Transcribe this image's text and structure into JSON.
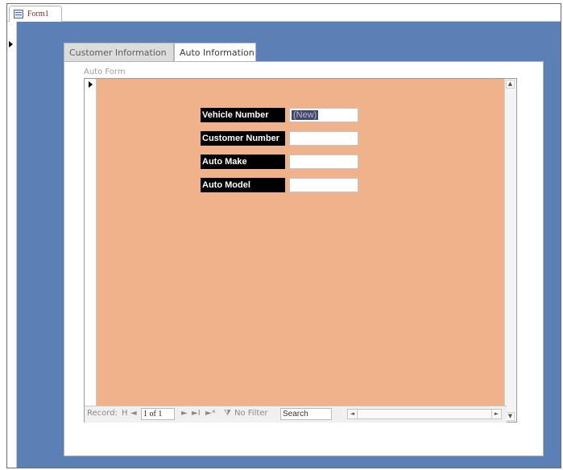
{
  "doc_tab": {
    "label": "Form1",
    "icon": "form-icon"
  },
  "tabs": [
    {
      "label": "Customer Information",
      "active": false
    },
    {
      "label": "Auto Information",
      "active": true
    }
  ],
  "subform": {
    "label": "Auto Form",
    "background_color": "#f0b28b",
    "fields": [
      {
        "label": "Vehicle Number",
        "value": "(New)"
      },
      {
        "label": "Customer Number",
        "value": ""
      },
      {
        "label": "Auto Make",
        "value": ""
      },
      {
        "label": "Auto Model",
        "value": ""
      }
    ]
  },
  "navigation": {
    "record_label": "Record:",
    "first_glyph": "H",
    "prev_glyph": "◄",
    "record_value": "1 of 1",
    "next_glyph": "►",
    "last_glyph": "►I",
    "new_glyph": "►*",
    "filter_label": "No Filter",
    "search_placeholder": "Search"
  },
  "colors": {
    "detail_background": "#5b80b6",
    "label_background": "#000000"
  }
}
